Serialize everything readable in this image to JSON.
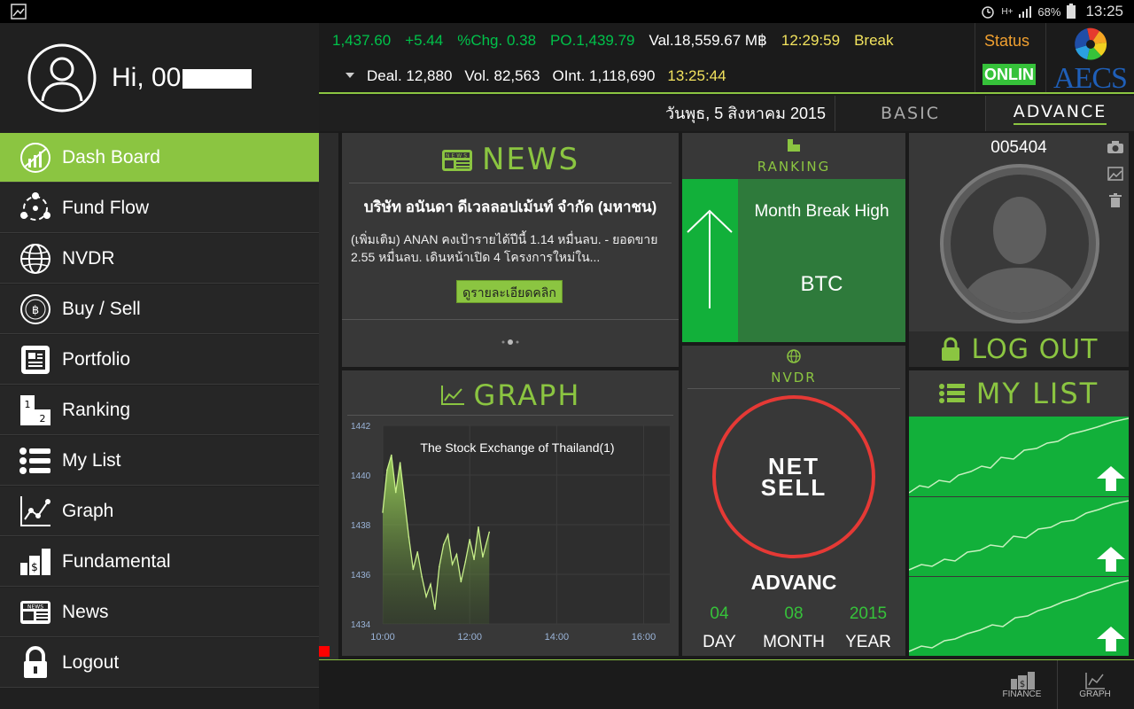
{
  "status_bar": {
    "battery": "68%",
    "time": "13:25"
  },
  "sidebar": {
    "greeting": "Hi, 00",
    "items": [
      {
        "label": "Dash Board",
        "icon": "dashboard-icon"
      },
      {
        "label": "Fund Flow",
        "icon": "fund-flow-icon"
      },
      {
        "label": "NVDR",
        "icon": "globe-icon"
      },
      {
        "label": "Buy / Sell",
        "icon": "buy-sell-icon"
      },
      {
        "label": "Portfolio",
        "icon": "portfolio-icon"
      },
      {
        "label": "Ranking",
        "icon": "ranking-icon"
      },
      {
        "label": "My List",
        "icon": "list-icon"
      },
      {
        "label": "Graph",
        "icon": "graph-icon"
      },
      {
        "label": "Fundamental",
        "icon": "fundamental-icon"
      },
      {
        "label": "News",
        "icon": "news-icon"
      },
      {
        "label": "Logout",
        "icon": "lock-icon"
      }
    ]
  },
  "ticker": {
    "index": "1,437.60",
    "change": "+5.44",
    "pct_chg": "%Chg. 0.38",
    "po": "PO.1,439.79",
    "val": "Val.18,559.67 M฿",
    "time1": "12:29:59",
    "status_word": "Break",
    "deal": "Deal. 12,880",
    "vol": "Vol. 82,563",
    "oint": "OInt. 1,118,690",
    "time2": "13:25:44"
  },
  "status_panel": {
    "label": "Status",
    "value": "ONLIN"
  },
  "logo": {
    "text": "AECS"
  },
  "date_row": {
    "date": "วันพุธ, 5 สิงหาคม 2015",
    "tab_basic": "BASIC",
    "tab_advance": "ADVANCE"
  },
  "news": {
    "title": "NEWS",
    "headline": "บริษัท อนันดา ดีเวลลอปเม้นท์ จำกัด (มหาชน)",
    "body": "(เพิ่มเติม) ANAN คงเป้ารายได้ปีนี้ 1.14 หมื่นลบ. - ยอดขาย 2.55 หมื่นลบ. เดินหน้าเปิด 4 โครงการใหม่ใน...",
    "button": "ดูรายละเอียดคลิก"
  },
  "ranking": {
    "title": "RANKING",
    "label": "Month Break High",
    "symbol": "BTC"
  },
  "profile": {
    "id": "005404",
    "logout": "LOG OUT"
  },
  "graph": {
    "title": "GRAPH"
  },
  "nvdr": {
    "title": "NVDR",
    "net": "NET",
    "sell": "SELL",
    "symbol": "ADVANC",
    "day_val": "04",
    "month_val": "08",
    "year_val": "2015",
    "day_label": "DAY",
    "month_label": "MONTH",
    "year_label": "YEAR"
  },
  "mylist": {
    "title": "MY LIST"
  },
  "bottom": {
    "finance": "FINANCE",
    "graph": "GRAPH"
  },
  "colors": {
    "accent": "#8bc541",
    "up": "#00c24a",
    "down": "#e53935",
    "time": "#f2e35e"
  },
  "chart_data": {
    "type": "area",
    "title": "The Stock Exchange of Thailand(1)",
    "x_tick_labels": [
      "10:00",
      "12:00",
      "14:00",
      "16:00"
    ],
    "y_tick_labels": [
      "1442",
      "1440",
      "1438",
      "1436",
      "1434"
    ],
    "ylim": [
      1434,
      1442
    ],
    "x_hours": [
      10.0,
      10.1,
      10.2,
      10.3,
      10.4,
      10.5,
      10.6,
      10.7,
      10.8,
      10.9,
      11.0,
      11.1,
      11.2,
      11.3,
      11.4,
      11.5,
      11.6,
      11.7,
      11.8,
      11.9,
      12.0,
      12.1,
      12.2,
      12.3,
      12.45
    ],
    "values": [
      1438.5,
      1440.2,
      1440.8,
      1439.3,
      1440.5,
      1439.0,
      1437.5,
      1436.2,
      1436.9,
      1435.9,
      1435.1,
      1435.6,
      1434.6,
      1436.3,
      1437.2,
      1437.6,
      1436.4,
      1436.8,
      1435.7,
      1436.5,
      1437.4,
      1436.6,
      1437.9,
      1436.7,
      1437.7
    ]
  }
}
